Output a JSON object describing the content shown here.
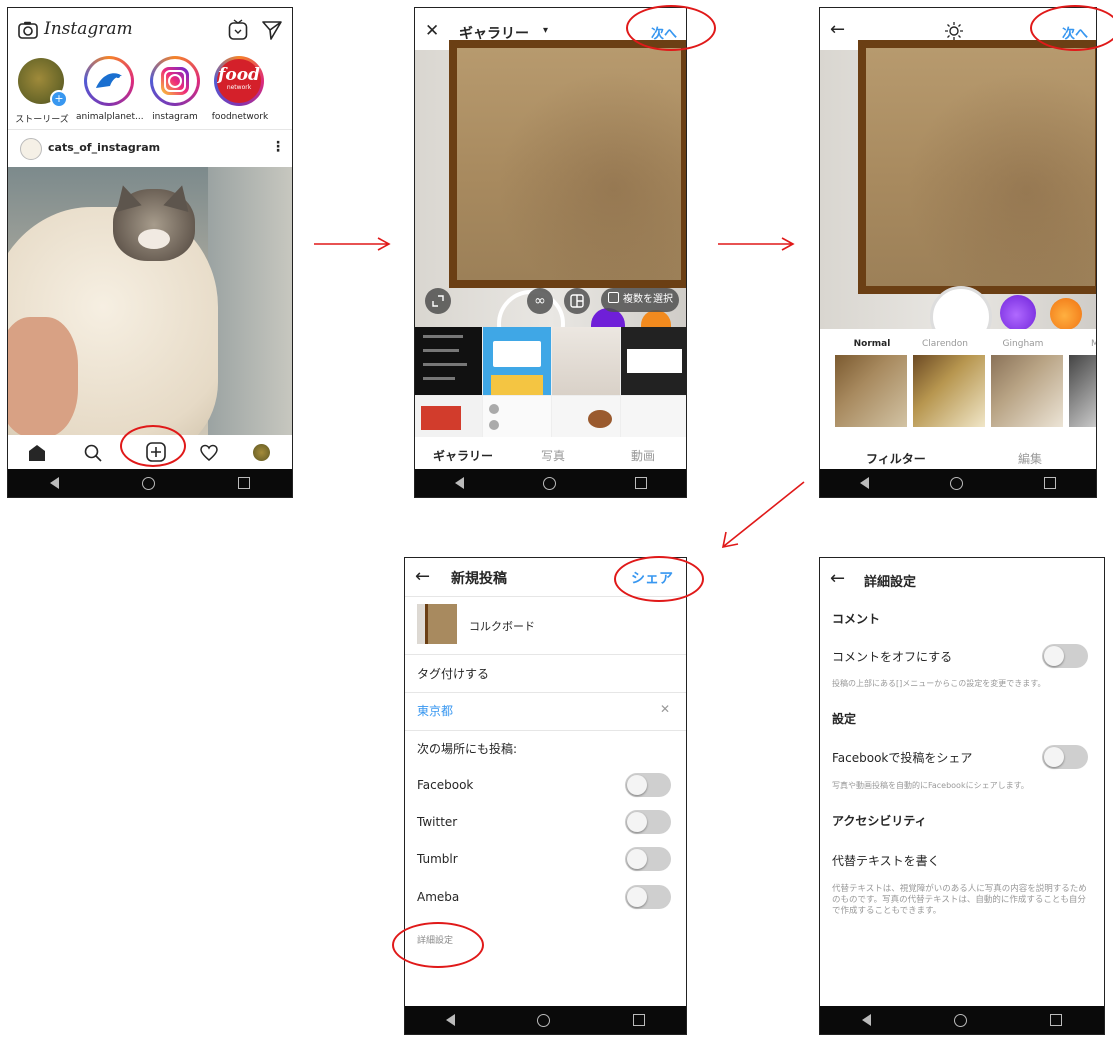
{
  "screen1": {
    "app_title": "Instagram",
    "stories": [
      {
        "label": "ストーリーズ"
      },
      {
        "label": "animalplanet..."
      },
      {
        "label": "instagram"
      },
      {
        "label": "foodnetwork"
      }
    ],
    "food_logo": "food",
    "food_logo_sub": "network",
    "post_user": "cats_of_instagram",
    "more": "⋮"
  },
  "screen2": {
    "close": "✕",
    "title": "ギャラリー",
    "title_arrow": "▾",
    "next": "次へ",
    "infinity": "∞",
    "multi_select": "複数を選択",
    "tabs": [
      "ギャラリー",
      "写真",
      "動画"
    ]
  },
  "screen3": {
    "back": "←",
    "next": "次へ",
    "filters": [
      "Normal",
      "Clarendon",
      "Gingham",
      "M"
    ],
    "tabs": [
      "フィルター",
      "編集"
    ]
  },
  "screen4": {
    "back": "←",
    "title": "新規投稿",
    "share": "シェア",
    "caption": "コルクボード",
    "tag": "タグ付けする",
    "location": "東京都",
    "clear": "✕",
    "also_post": "次の場所にも投稿:",
    "services": [
      "Facebook",
      "Twitter",
      "Tumblr",
      "Ameba"
    ],
    "advanced": "詳細設定"
  },
  "screen5": {
    "back": "←",
    "title": "詳細設定",
    "comment_header": "コメント",
    "comment_off": "コメントをオフにする",
    "comment_note": "投稿の上部にある[]メニューからこの設定を変更できます。",
    "settings_header": "設定",
    "fb_share": "Facebookで投稿をシェア",
    "fb_note": "写真や動画投稿を自動的にFacebookにシェアします。",
    "accessibility_header": "アクセシビリティ",
    "alt_text": "代替テキストを書く",
    "alt_note": "代替テキストは、視覚障がいのある人に写真の内容を説明するためのものです。写真の代替テキストは、自動的に作成することも自分で作成することもできます。"
  },
  "colors": {
    "annotation_red": "#e01919",
    "link_blue": "#3897f0",
    "nav_black": "#0a0a0a"
  }
}
